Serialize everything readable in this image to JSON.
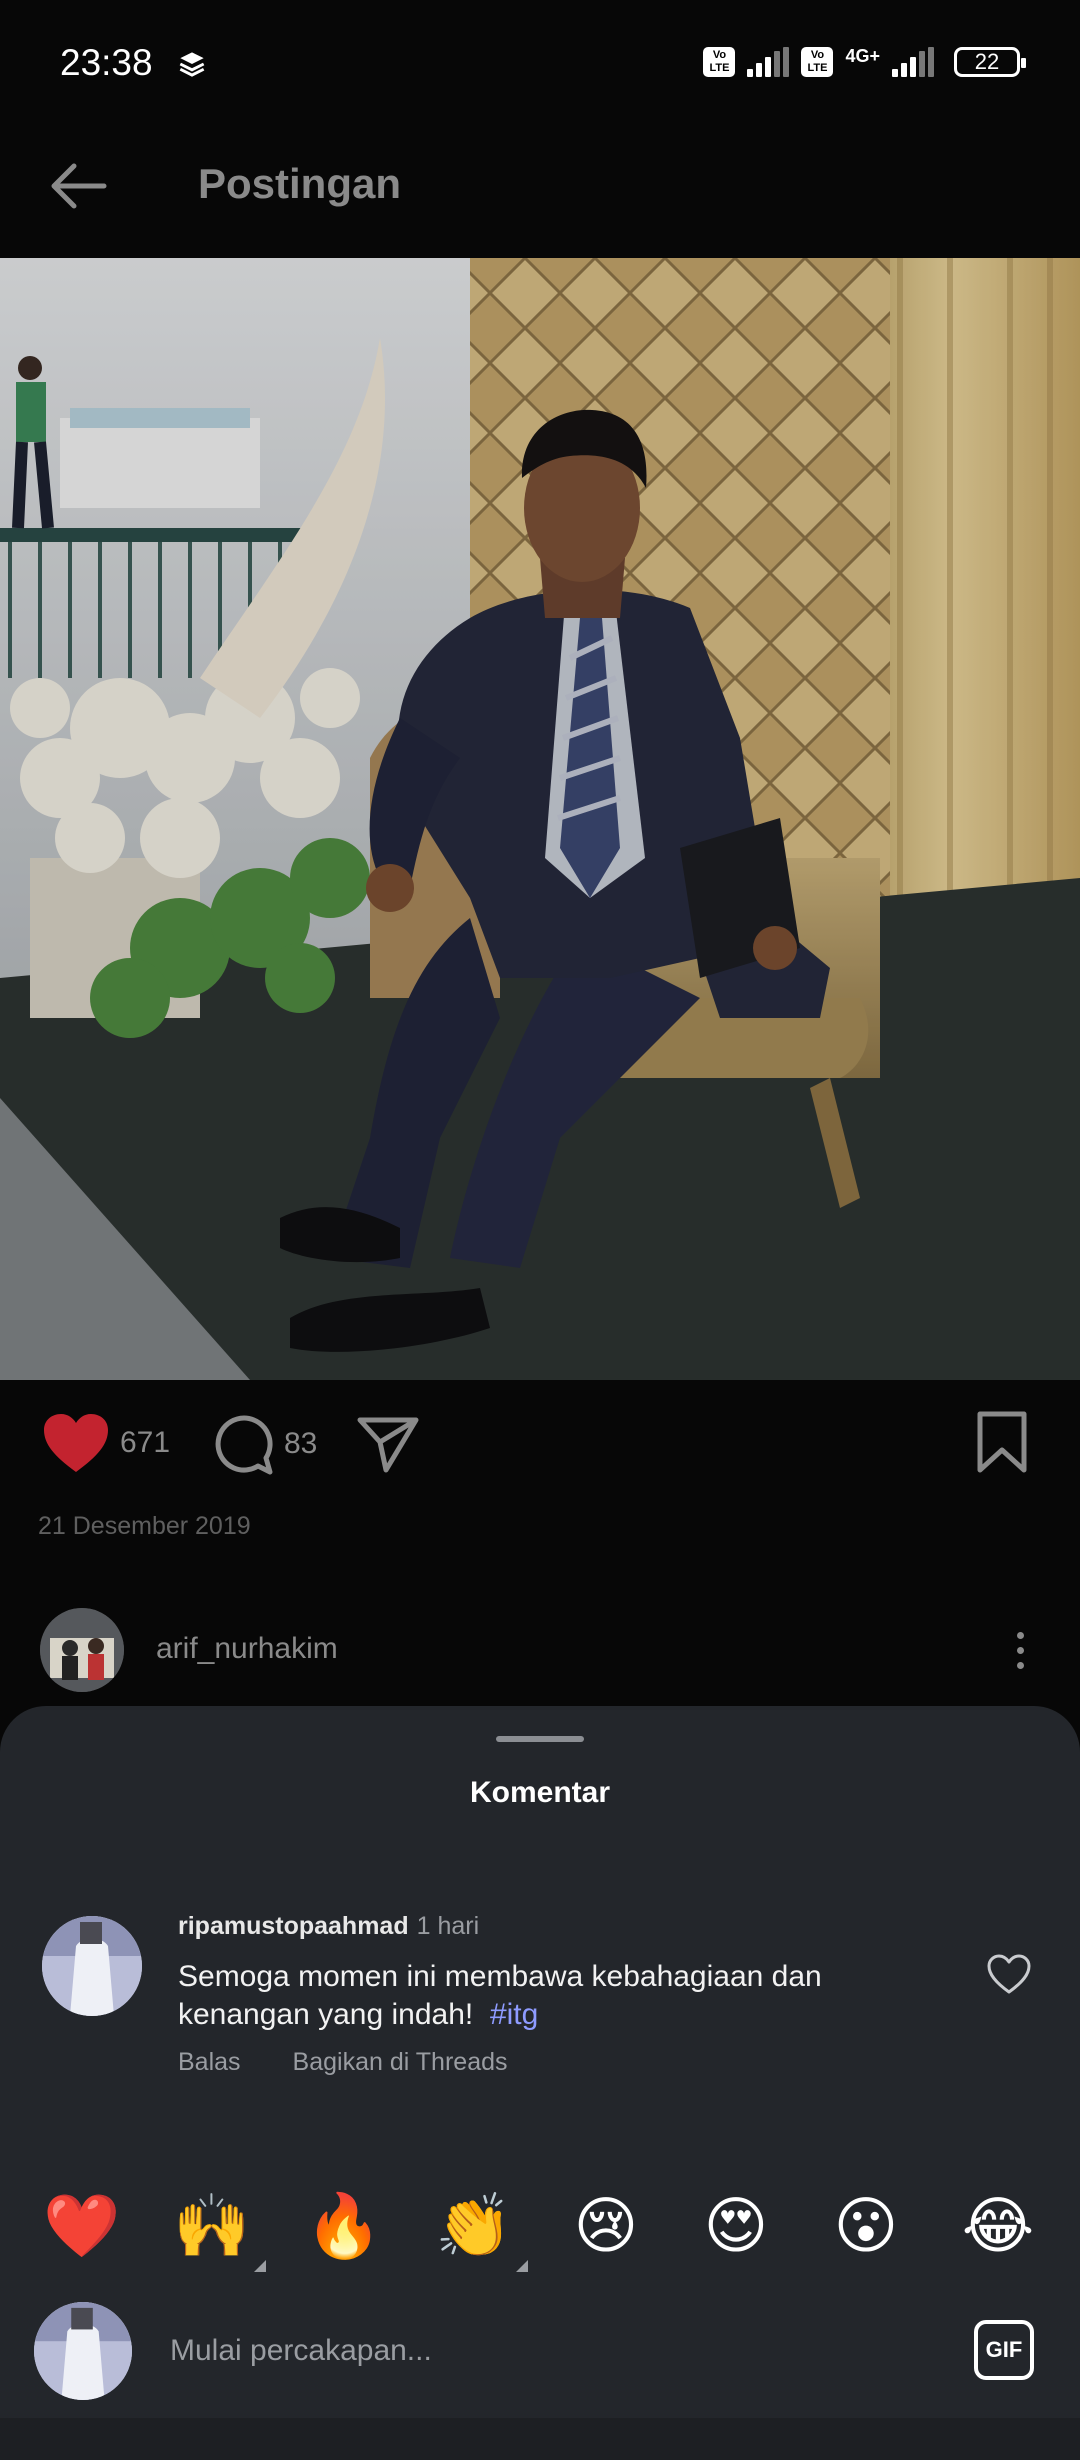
{
  "status_bar": {
    "time": "23:38",
    "volte1": "Vo\nLTE",
    "volte2": "Vo\nLTE",
    "network": "4G+",
    "battery": "22"
  },
  "header": {
    "title": "Postingan",
    "back_icon": "arrow-left-icon"
  },
  "post": {
    "likes": "671",
    "comments": "83",
    "date": "21 Desember 2019",
    "author": "arif_nurhakim",
    "colors": {
      "like": "#c3232f",
      "muted": "#8a8a8a"
    }
  },
  "sheet": {
    "title": "Komentar",
    "comment": {
      "user": "ripamustopaahmad",
      "time": "1 hari",
      "text": "Semoga momen ini membawa kebahagiaan dan kenangan yang indah!",
      "hashtag": "#itg",
      "reply_label": "Balas",
      "share_label": "Bagikan di Threads"
    },
    "emojis": [
      "❤️",
      "🙌",
      "🔥",
      "👏",
      "😢",
      "😍",
      "😮",
      "😂"
    ],
    "input": {
      "placeholder": "Mulai percakapan...",
      "gif_label": "GIF"
    }
  }
}
